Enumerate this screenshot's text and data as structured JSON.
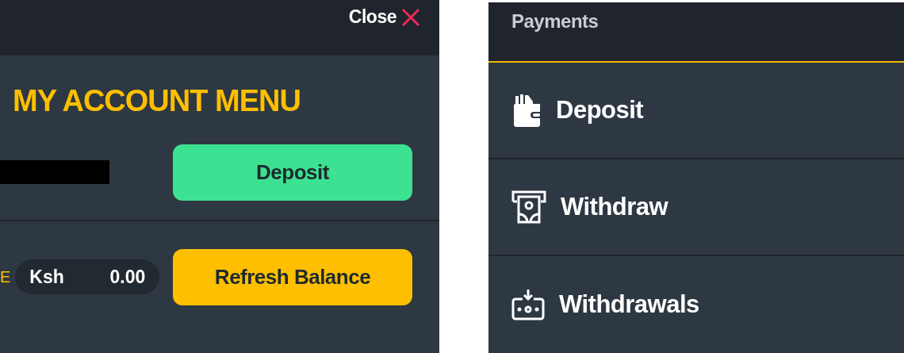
{
  "account_panel": {
    "close": {
      "label": "Close"
    },
    "title": "MY ACCOUNT MENU",
    "deposit_button": "Deposit",
    "balance_label": "E",
    "balance": {
      "currency": "Ksh",
      "amount": "0.00"
    },
    "refresh_button": "Refresh Balance"
  },
  "payments_panel": {
    "title": "Payments",
    "items": [
      {
        "label": "Deposit",
        "kind": "wallet"
      },
      {
        "label": "Withdraw",
        "kind": "atm"
      },
      {
        "label": "Withdrawals",
        "kind": "download"
      }
    ]
  }
}
